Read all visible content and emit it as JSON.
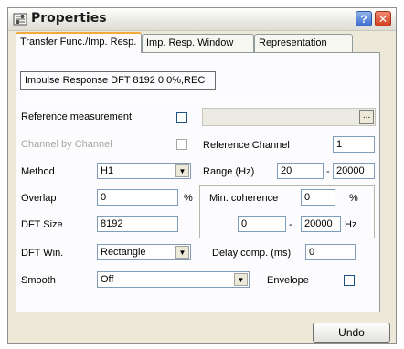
{
  "window": {
    "title": "Properties",
    "help_glyph": "?",
    "close_glyph": "✕"
  },
  "tabs": [
    {
      "label": "Transfer Func./Imp. Resp.",
      "active": true
    },
    {
      "label": "Imp. Resp. Window",
      "active": false
    },
    {
      "label": "Representation",
      "active": false
    }
  ],
  "status_text": "Impulse Response DFT 8192 0.0%,REC",
  "reference": {
    "label": "Reference measurement",
    "checked": false,
    "value": "",
    "browse_label": "..."
  },
  "channel_by_channel": {
    "label": "Channel by Channel",
    "checked": false,
    "disabled": true
  },
  "reference_channel": {
    "label": "Reference Channel",
    "value": "1"
  },
  "method": {
    "label": "Method",
    "value": "H1"
  },
  "range": {
    "label": "Range (Hz)",
    "from": "20",
    "separator": "-",
    "to": "20000"
  },
  "overlap": {
    "label": "Overlap",
    "value": "0",
    "unit": "%"
  },
  "min_coherence": {
    "label": "Min. coherence",
    "value": "0",
    "unit": "%",
    "from": "0",
    "separator": "-",
    "to": "20000",
    "freq_unit": "Hz"
  },
  "dft_size": {
    "label": "DFT Size",
    "value": "8192"
  },
  "dft_win": {
    "label": "DFT Win.",
    "value": "Rectangle"
  },
  "delay_comp": {
    "label": "Delay comp. (ms)",
    "value": "0"
  },
  "smooth": {
    "label": "Smooth",
    "value": "Off"
  },
  "envelope": {
    "label": "Envelope",
    "checked": false
  },
  "undo_label": "Undo",
  "dropdown_glyph": "▼"
}
